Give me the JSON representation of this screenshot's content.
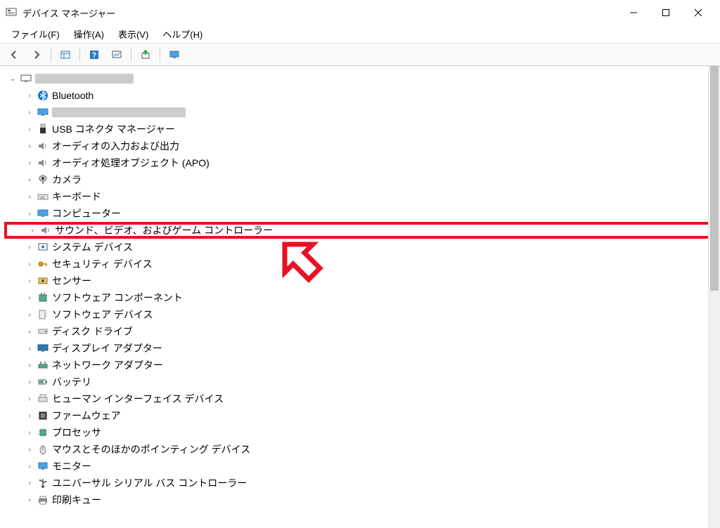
{
  "window": {
    "title": "デバイス マネージャー"
  },
  "menu": {
    "file": "ファイル(F)",
    "action": "操作(A)",
    "view": "表示(V)",
    "help": "ヘルプ(H)"
  },
  "tree": {
    "root": {
      "label": ""
    },
    "items": [
      {
        "label": "Bluetooth",
        "icon": "bluetooth"
      },
      {
        "label": "",
        "icon": "monitor",
        "redacted": true
      },
      {
        "label": "USB コネクタ マネージャー",
        "icon": "usb"
      },
      {
        "label": "オーディオの入力および出力",
        "icon": "speaker"
      },
      {
        "label": "オーディオ処理オブジェクト (APO)",
        "icon": "speaker"
      },
      {
        "label": "カメラ",
        "icon": "camera"
      },
      {
        "label": "キーボード",
        "icon": "keyboard"
      },
      {
        "label": "コンピューター",
        "icon": "computer"
      },
      {
        "label": "サウンド、ビデオ、およびゲーム コントローラー",
        "icon": "speaker",
        "highlighted": true
      },
      {
        "label": "システム デバイス",
        "icon": "system"
      },
      {
        "label": "セキュリティ デバイス",
        "icon": "security"
      },
      {
        "label": "センサー",
        "icon": "sensor"
      },
      {
        "label": "ソフトウェア コンポーネント",
        "icon": "component"
      },
      {
        "label": "ソフトウェア デバイス",
        "icon": "software"
      },
      {
        "label": "ディスク ドライブ",
        "icon": "disk"
      },
      {
        "label": "ディスプレイ アダプター",
        "icon": "display"
      },
      {
        "label": "ネットワーク アダプター",
        "icon": "network"
      },
      {
        "label": "バッテリ",
        "icon": "battery"
      },
      {
        "label": "ヒューマン インターフェイス デバイス",
        "icon": "hid"
      },
      {
        "label": "ファームウェア",
        "icon": "firmware"
      },
      {
        "label": "プロセッサ",
        "icon": "processor"
      },
      {
        "label": "マウスとそのほかのポインティング デバイス",
        "icon": "mouse"
      },
      {
        "label": "モニター",
        "icon": "monitor2"
      },
      {
        "label": "ユニバーサル シリアル バス コントローラー",
        "icon": "usbctrl"
      },
      {
        "label": "印刷キュー",
        "icon": "printer"
      }
    ]
  }
}
